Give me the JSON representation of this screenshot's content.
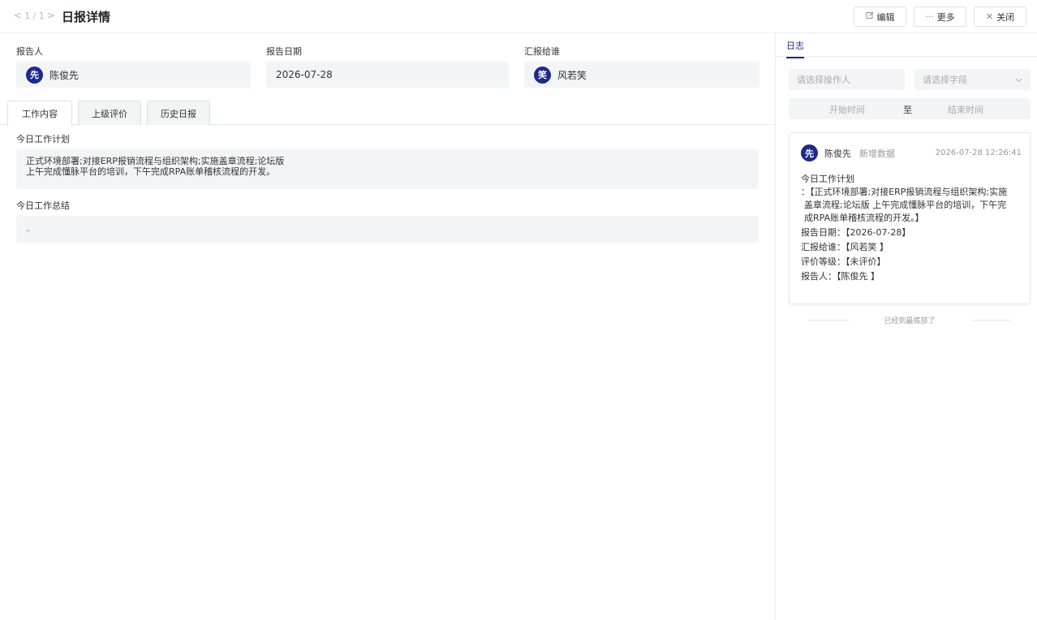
{
  "header": {
    "pager_prev": "<",
    "pager_text": "1 / 1",
    "pager_next": ">",
    "title": "日报详情",
    "edit_label": "编辑",
    "more_label": "更多",
    "close_label": "关闭"
  },
  "fields": {
    "reporter_label": "报告人",
    "reporter_avatar": "先",
    "reporter_value": "陈俊先",
    "date_label": "报告日期",
    "date_value": "2026-07-28",
    "to_label": "汇报给谁",
    "to_avatar": "笑",
    "to_value": "风若笑"
  },
  "tabs": [
    {
      "label": "工作内容",
      "active": true
    },
    {
      "label": "上级评价",
      "active": false
    },
    {
      "label": "历史日报",
      "active": false
    }
  ],
  "content": {
    "plan_label": "今日工作计划",
    "plan_line1": "正式环境部署;对接ERP报销流程与组织架构;实施盖章流程;论坛版",
    "plan_line2": "上午完成懂脉平台的培训，下午完成RPA账单稽核流程的开发。",
    "summary_label": "今日工作总结",
    "summary_value": "–"
  },
  "side": {
    "tab_label": "日志",
    "operator_placeholder": "请选择操作人",
    "field_placeholder": "请选择字段",
    "start_time": "开始时间",
    "to": "至",
    "end_time": "结束时间",
    "log": {
      "avatar": "先",
      "name": "陈俊先",
      "action": "新增数据",
      "time": "2026-07-28 12:26:41",
      "plan_title": "今日工作计划",
      "plan_text1": "：【正式环境部署;对接ERP报销流程与组织架构;实施",
      "plan_text2": "盖章流程;论坛版 上午完成懂脉平台的培训，下午完",
      "plan_text3": "成RPA账单稽核流程的开发。】",
      "date_row": "报告日期：【2026-07-28】",
      "to_row": "汇报给谁：【风若笑 】",
      "grade_row": "评价等级：【未评价】",
      "reporter_row": "报告人：【陈俊先 】"
    },
    "bottom_note": "已经到最底部了"
  },
  "colors": {
    "accent": "#1d2a8a",
    "field_bg": "#f3f4f7",
    "border": "#e4e7ed"
  }
}
